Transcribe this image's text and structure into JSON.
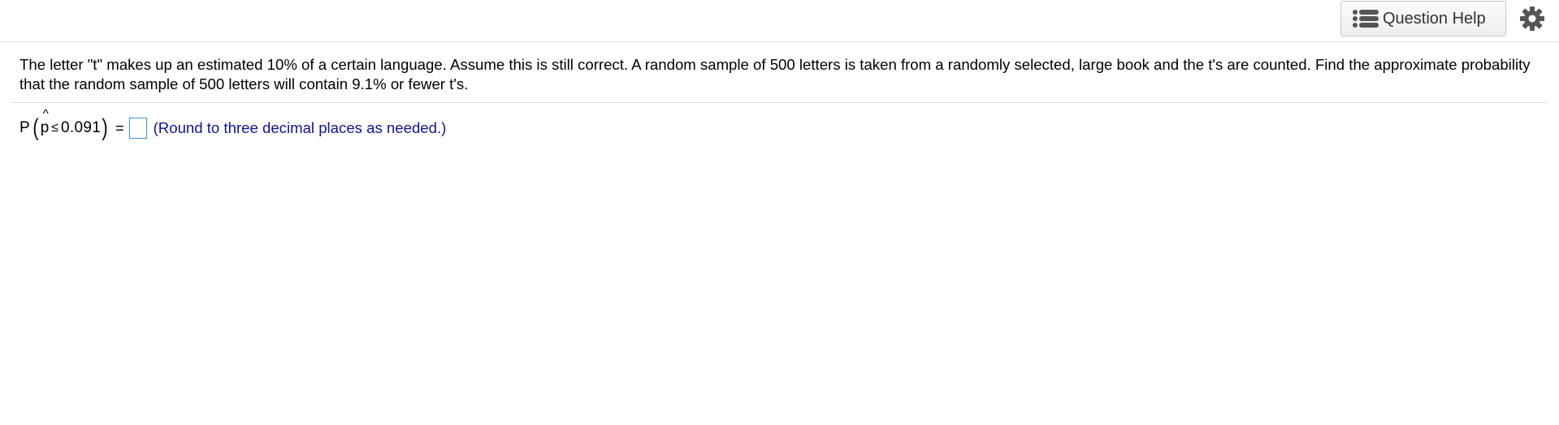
{
  "toolbar": {
    "help_label": "Question Help",
    "help_icon": "list-icon",
    "settings_icon": "gear-icon",
    "icon_color": "#555555"
  },
  "question": {
    "text": "The letter \"t\" makes up an estimated 10% of a certain language. Assume this is still correct. A random sample of 500 letters is taken from a randomly selected, large book and the t's are counted. Find the approximate probability that the random sample of 500 letters will contain 9.1% or fewer t's."
  },
  "answer": {
    "prob_label": "P",
    "open_paren": "(",
    "variable": "p",
    "hat": "^",
    "relation": "≤",
    "value": "0.091",
    "close_paren": ")",
    "equals": "=",
    "input_value": "",
    "hint": "(Round to three decimal places as needed.)",
    "input_border_color": "#3f8fd2",
    "hint_color": "#12128e"
  }
}
